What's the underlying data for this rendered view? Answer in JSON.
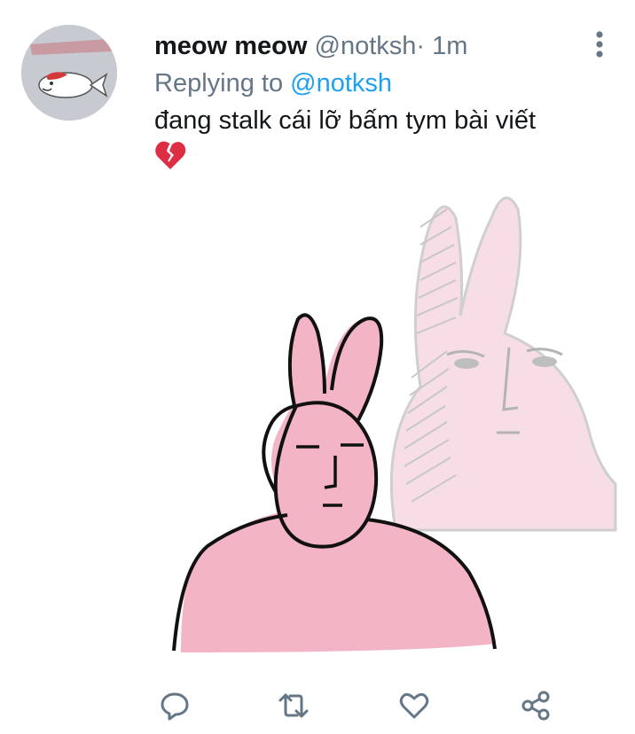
{
  "tweet": {
    "display_name": "meow meow",
    "handle": "@notksh",
    "separator": "·",
    "time": "1m",
    "replying_prefix": "Replying to",
    "replying_to": "@notksh",
    "text": "đang stalk cái lỡ bấm tym bài viết",
    "emoji": "broken-heart"
  },
  "media": {
    "description_icon": "pink-rabbit-meme-image"
  },
  "actions": [
    {
      "icon": "reply-icon"
    },
    {
      "icon": "retweet-icon"
    },
    {
      "icon": "like-icon"
    },
    {
      "icon": "share-icon"
    }
  ],
  "colors": {
    "text": "#14171a",
    "secondary": "#657786",
    "link": "#1da1f2",
    "rabbit_pink": "#f4b6c8",
    "ghost_pink": "#f7e1e8"
  }
}
